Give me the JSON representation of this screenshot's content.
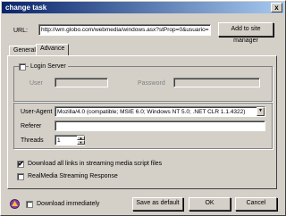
{
  "window": {
    "title": "change task",
    "close_glyph": "x"
  },
  "url_section": {
    "label": "URL:",
    "value": "http://wm.globo.com/webmedia/windows.asx?stProp=0&usuario=",
    "add_button": "Add to site manager"
  },
  "tabs": [
    {
      "label": "General"
    },
    {
      "label": "Advance"
    }
  ],
  "login": {
    "checkbox_label": "Login Server",
    "user_label": "User",
    "password_label": "Password",
    "user_value": "",
    "password_value": ""
  },
  "advanced": {
    "user_agent_label": "User-Agent",
    "user_agent_value": "Mozilla/4.0 (compatible; MSIE 6.0; Windows NT 5.0; .NET CLR 1.1.4322)",
    "referer_label": "Referer",
    "referer_value": "",
    "threads_label": "Threads",
    "threads_value": "1"
  },
  "options": {
    "download_all_label": "Download all links in streaming media script files",
    "download_all_checked": true,
    "realmedia_label": "RealMedia Streaming Response",
    "realmedia_checked": false
  },
  "footer": {
    "download_immediately_label": "Download immediately",
    "download_immediately_checked": false,
    "save_default_button": "Save as default",
    "ok_button": "OK",
    "cancel_button": "Cancel"
  },
  "icons": {
    "app_icon": "app-logo-icon",
    "checkmark": "✔",
    "dropdown_arrow": "▼",
    "spin_up": "▲",
    "spin_down": "▼"
  }
}
